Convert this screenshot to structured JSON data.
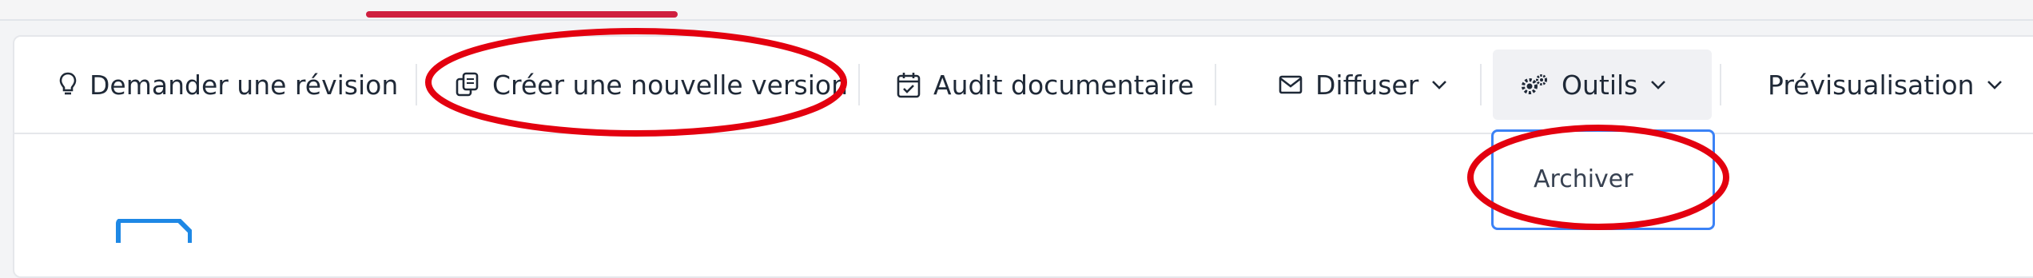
{
  "toolbar": {
    "request_revision": "Demander une révision",
    "create_version": "Créer une nouvelle version",
    "document_audit": "Audit documentaire",
    "distribute": "Diffuser",
    "tools": "Outils",
    "preview": "Prévisualisation"
  },
  "tools_menu": {
    "items": [
      {
        "label": "Archiver"
      }
    ]
  },
  "colors": {
    "accent_underline": "#cf1f3f",
    "annotation": "#e3000f",
    "dropdown_border": "#3b82f6",
    "doc_icon": "#1e88e5"
  },
  "icons": {
    "request_revision": "lightbulb-icon",
    "create_version": "copy-icon",
    "document_audit": "calendar-check-icon",
    "distribute": "envelope-icon",
    "tools": "cogs-icon",
    "chevron": "chevron-down-icon"
  }
}
